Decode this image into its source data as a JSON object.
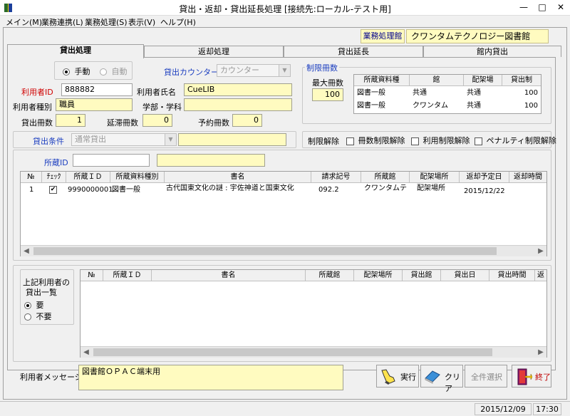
{
  "window": {
    "title": "貸出・返却・貸出延長処理 [接続先:ローカル-テスト用]",
    "minimize": "—",
    "maximize": "□",
    "close": "✕"
  },
  "menu": [
    "メイン(M)",
    "業務連携(L)",
    "業務処理(S)",
    "表示(V)",
    "ヘルプ(H)"
  ],
  "header": {
    "library_label": "業務処理館",
    "library_value": "クワンタムテクノロジー図書館"
  },
  "tabs": [
    "貸出処理",
    "返却処理",
    "貸出延長",
    "館内貸出"
  ],
  "mode": {
    "manual": "手動",
    "auto": "自動",
    "selected": "manual"
  },
  "counter": {
    "label": "貸出カウンター",
    "value": "カウンター"
  },
  "user": {
    "id_label": "利用者ID",
    "id_value": "888882",
    "name_label": "利用者氏名",
    "name_value": "CueLIB",
    "type_label": "利用者種別",
    "type_value": "職員",
    "dept_label": "学部・学科",
    "dept_value": ""
  },
  "counts": {
    "loan_label": "貸出冊数",
    "loan_value": "1",
    "overdue_label": "延滞冊数",
    "overdue_value": "0",
    "reserve_label": "予約冊数",
    "reserve_value": "0"
  },
  "limit": {
    "group_title": "制限冊数",
    "max_label": "最大冊数",
    "max_value": "100",
    "columns": [
      "所蔵資料種",
      "館",
      "配架場",
      "貸出制"
    ],
    "rows": [
      [
        "図書一般",
        "共通",
        "共通",
        "100"
      ],
      [
        "図書一般",
        "クワンタム",
        "共通",
        "100"
      ]
    ]
  },
  "loan_condition": {
    "label": "貸出条件",
    "value": "通常貸出"
  },
  "restriction": {
    "label": "制限解除",
    "options": [
      "冊数制限解除",
      "利用制限解除",
      "ペナルティ制限解除"
    ]
  },
  "holding": {
    "label": "所蔵ID"
  },
  "loan_grid": {
    "columns": [
      "№",
      "ﾁｪｯｸ",
      "所蔵ＩＤ",
      "所蔵資料種別",
      "書名",
      "請求記号",
      "所蔵館",
      "配架場所",
      "返却予定日",
      "返却時間"
    ],
    "rows": [
      {
        "no": "1",
        "checked": "✔",
        "holding_id": "9990000001",
        "material_type": "図書一般",
        "title": "古代国東文化の謎 : 宇佐神道と国東文化",
        "call_no": "092.2",
        "library": "クワンタムテ",
        "location": "配架場所",
        "due_date": "2015/12/22",
        "due_time": ""
      }
    ]
  },
  "history": {
    "label_line1": "上記利用者の",
    "label_line2": "貸出一覧",
    "required": "要",
    "not_required": "不要",
    "selected": "required",
    "columns": [
      "№",
      "所蔵ＩＤ",
      "書名",
      "所蔵館",
      "配架場所",
      "貸出館",
      "貸出日",
      "貸出時間",
      "返"
    ]
  },
  "message": {
    "label": "利用者メッセージ",
    "value": "図書館ＯＰＡＣ端末用"
  },
  "buttons": {
    "execute": "実行",
    "clear": "クリア",
    "select_all": "全件選択",
    "exit": "終了"
  },
  "status": {
    "date": "2015/12/09",
    "time": "17:30"
  },
  "colors": {
    "field_yellow": "#fffbc0",
    "required_red": "#d00000",
    "link_blue": "#1a3dbf"
  }
}
